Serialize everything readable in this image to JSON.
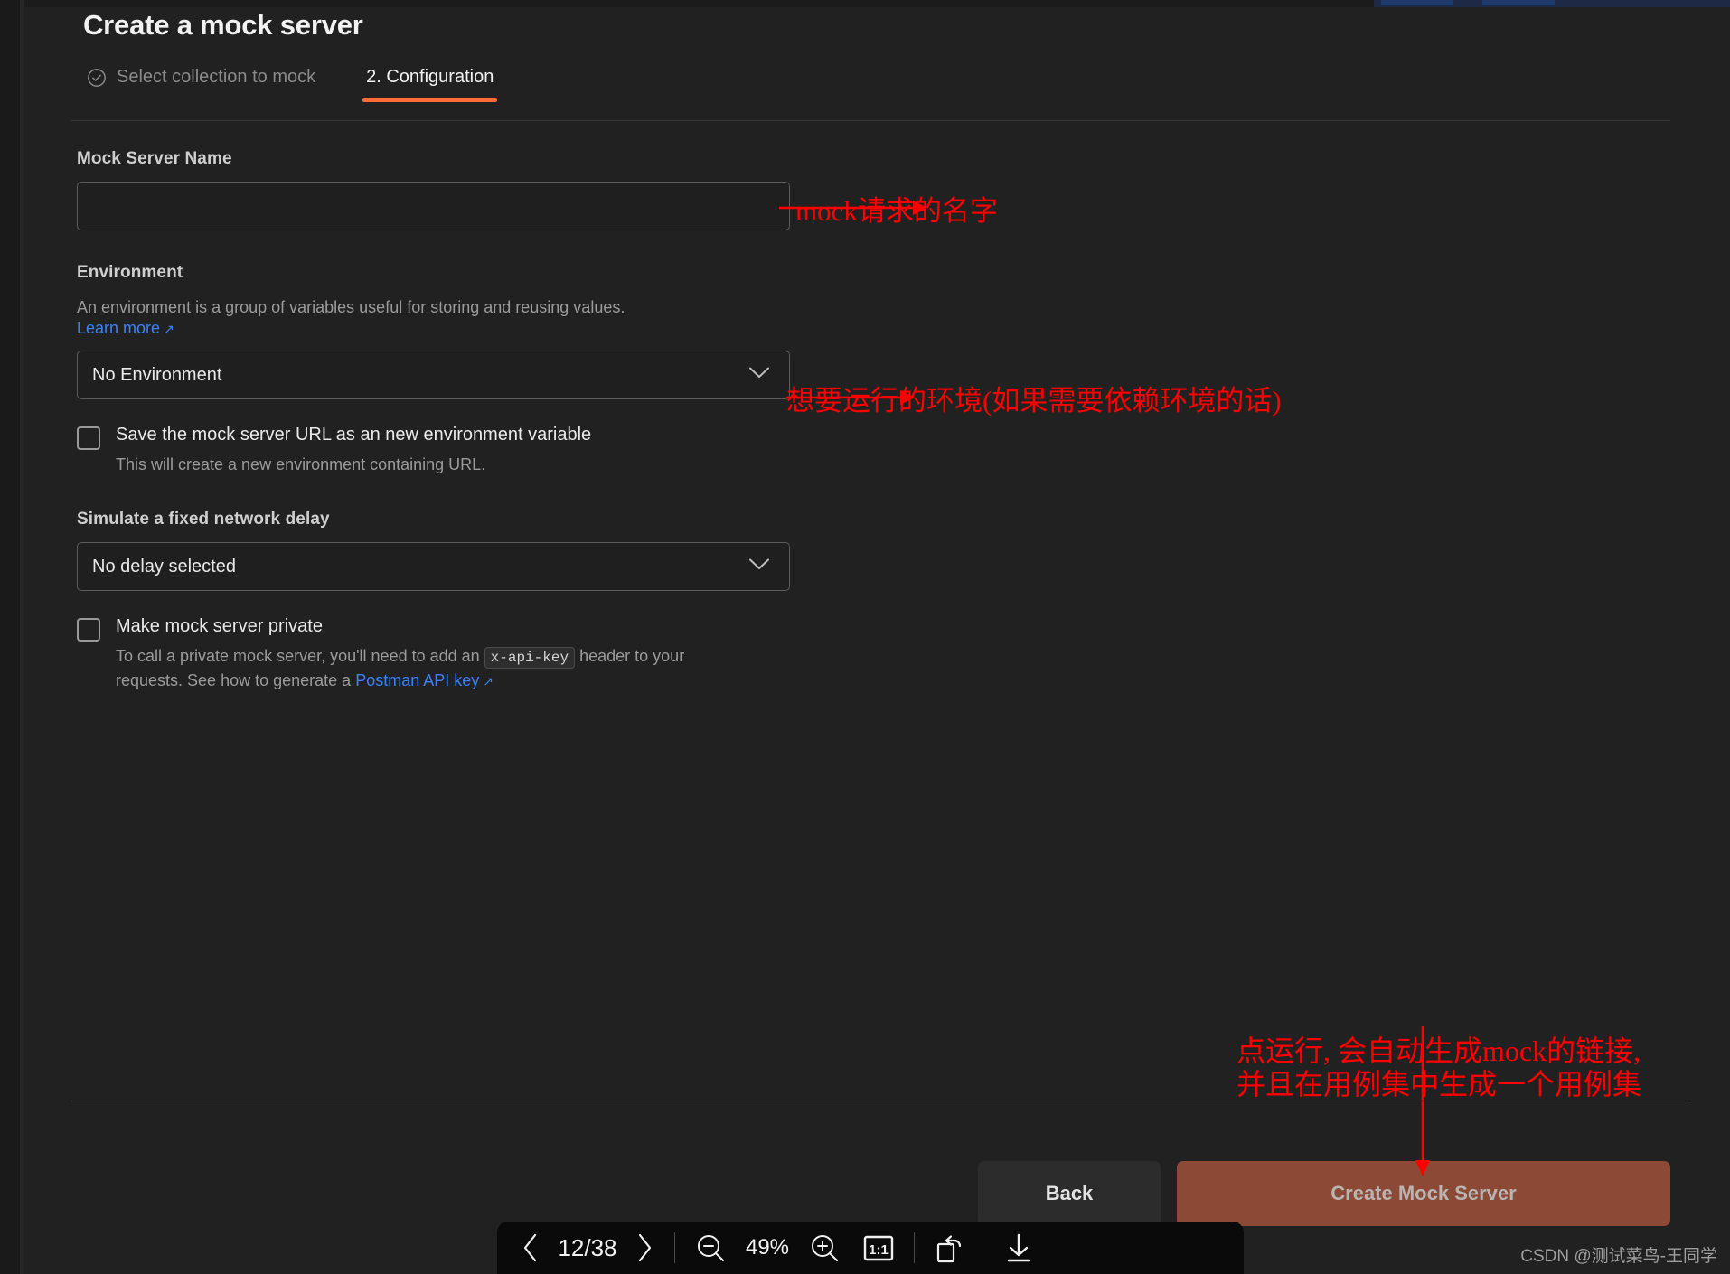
{
  "header": {
    "title": "Create a mock server",
    "steps": [
      {
        "label": "Select collection to mock",
        "state": "done",
        "icon": "check-circle-icon"
      },
      {
        "label": "2. Configuration",
        "state": "active"
      }
    ]
  },
  "form": {
    "mock_server_name": {
      "label": "Mock Server Name",
      "value": "",
      "placeholder": ""
    },
    "environment": {
      "label": "Environment",
      "description": "An environment is a group of variables useful for storing and reusing values.",
      "learn_more": "Learn more",
      "learn_more_icon": "external-link-icon",
      "selected": "No Environment",
      "chevron_icon": "chevron-down-icon"
    },
    "save_url_checkbox": {
      "checked": false,
      "label": "Save the mock server URL as an new environment variable",
      "sublabel": "This will create a new environment containing URL."
    },
    "delay": {
      "label": "Simulate a fixed network delay",
      "selected": "No delay selected",
      "chevron_icon": "chevron-down-icon"
    },
    "private_checkbox": {
      "checked": false,
      "label": "Make mock server private",
      "sublabel_part1": "To call a private mock server, you'll need to add an",
      "sublabel_code": "x-api-key",
      "sublabel_part2": "header to your requests. See how to generate a",
      "sublabel_link": "Postman API key",
      "sublabel_link_icon": "external-link-icon"
    }
  },
  "footer": {
    "back_label": "Back",
    "create_label": "Create Mock Server"
  },
  "viewer_toolbar": {
    "prev_icon": "chevron-left-icon",
    "page_indicator": "12/38",
    "next_icon": "chevron-right-icon",
    "zoom_out_icon": "zoom-out-icon",
    "zoom_level": "49%",
    "zoom_in_icon": "zoom-in-icon",
    "actual_size_icon": "one-to-one-icon",
    "actual_size_label": "1:1",
    "rotate_icon": "rotate-icon",
    "download_icon": "download-icon"
  },
  "annotations": {
    "note_name": "mock请求的名字",
    "note_environment": "想要运行的环境(如果需要依赖环境的话)",
    "note_create_line1": "点运行, 会自动生成mock的链接,",
    "note_create_line2": "并且在用例集中生成一个用例集"
  },
  "watermark": "CSDN @测试菜鸟-王同学",
  "colors": {
    "accent": "#ff6c37",
    "link": "#3b82f6",
    "annotation": "#ff0000",
    "primary_button": "#8c4a36",
    "background": "#212121"
  }
}
